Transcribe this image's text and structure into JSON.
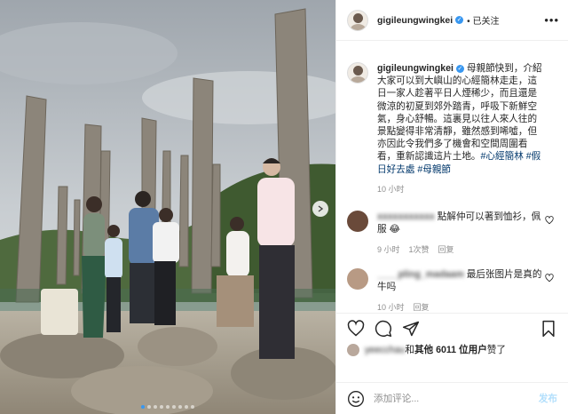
{
  "header": {
    "username": "gigileungwingkei",
    "verified_mark": "✓",
    "follow_label": "• 已关注",
    "more_label": "•••"
  },
  "caption": {
    "username": "gigileungwingkei",
    "text": " 母親節快到，介紹大家可以到大嶼山的心經簡林走走，這日一家人趁著平日人煙稀少，而且還是微涼的初夏到郊外踏青，呼吸下新鮮空氣，身心舒暢。這裏見以往人來人往的景點變得非常清靜，雖然感到唏噓，但亦因此令我們多了機會和空間周圍看看，重新認識這片土地。",
    "hashtag_1": "#心經簡林",
    "hashtag_2": "#假日好去處",
    "hashtag_3": "#母親節",
    "time": "10 小时"
  },
  "comments": [
    {
      "username_blurred": "xxxxxxxxxxx",
      "text": "點解仲可以著到恤衫，佩服 😂",
      "time": "9 小时",
      "likes": "1次赞",
      "reply": "回复"
    },
    {
      "username_blurred": "____pling_madaam",
      "text": "最后张图片是真的牛吗",
      "time": "10 小时",
      "reply": "回复"
    }
  ],
  "likes": {
    "user_blurred": "yeecchau",
    "and": " 和 ",
    "others": "其他 6011 位用户",
    "suffix": " 赞了"
  },
  "comment_box": {
    "placeholder": "添加评论...",
    "post_label": "发布"
  },
  "carousel": {
    "slide_count": 9,
    "active_index": 0
  },
  "colors": {
    "accent": "#3897f0",
    "hashtag": "#00376b",
    "meta": "#8e8e8e"
  }
}
